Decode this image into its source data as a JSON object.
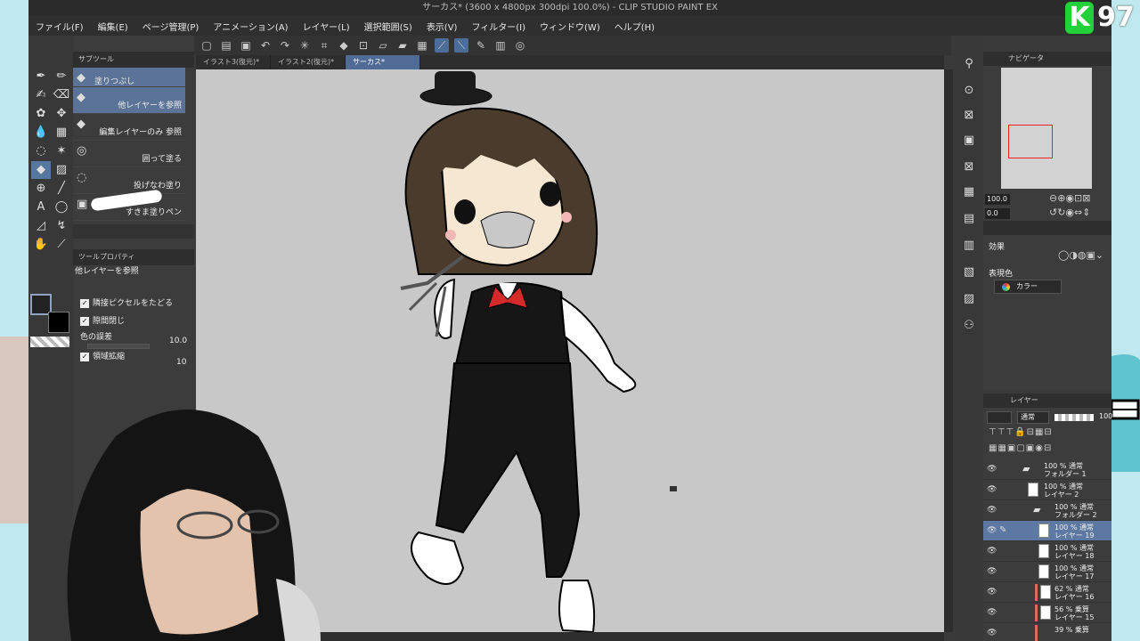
{
  "stream": {
    "badge_letter": "K",
    "badge_number": "97"
  },
  "app": {
    "title": "サーカス* (3600 x 4800px 300dpi 100.0%)  - CLIP STUDIO PAINT EX",
    "menu": [
      "ファイル(F)",
      "編集(E)",
      "ページ管理(P)",
      "アニメーション(A)",
      "レイヤー(L)",
      "選択範囲(S)",
      "表示(V)",
      "フィルター(I)",
      "ウィンドウ(W)",
      "ヘルプ(H)"
    ]
  },
  "subtool": {
    "header": "サブツール",
    "items": [
      "塗りつぶし",
      "他レイヤーを参照",
      "編集レイヤーのみ 参照",
      "囲って塗る",
      "投げなわ塗り",
      "すきま塗りペン"
    ]
  },
  "toolprop": {
    "header": "ツールプロパティ",
    "title": "他レイヤーを参照",
    "adjacent": "隣接ピクセルをたどる",
    "close_gap": "隙間閉じ",
    "tolerance_label": "色の誤差",
    "tolerance_value": "10.0",
    "expand_label": "領域拡縮",
    "expand_value": "10"
  },
  "tabs": [
    "イラスト3(復元)*",
    "イラスト2(復元)*",
    "サーカス*"
  ],
  "navigator": {
    "title": "ナビゲータ",
    "zoom": "100.0",
    "rotate": "0.0"
  },
  "effect": {
    "title": "効果",
    "color_label": "表現色",
    "color_value": "カラー"
  },
  "layers": {
    "title": "レイヤー",
    "blend": "通常",
    "opacity": "100",
    "items": [
      {
        "l1": "100 % 通常",
        "l2": "フォルダー 1",
        "type": "folder"
      },
      {
        "l1": "100 % 通常",
        "l2": "レイヤー 2",
        "type": "layer"
      },
      {
        "l1": "100 % 通常",
        "l2": "フォルダー 2",
        "type": "folder"
      },
      {
        "l1": "100 % 通常",
        "l2": "レイヤー 19",
        "type": "layer",
        "selected": true
      },
      {
        "l1": "100 % 通常",
        "l2": "レイヤー 18",
        "type": "layer"
      },
      {
        "l1": "100 % 通常",
        "l2": "レイヤー 17",
        "type": "layer"
      },
      {
        "l1": "62 % 通常",
        "l2": "レイヤー 16",
        "type": "layer",
        "marked": true
      },
      {
        "l1": "56 % 乗算",
        "l2": "レイヤー 15",
        "type": "layer",
        "marked": true
      },
      {
        "l1": "39 % 乗算",
        "l2": "",
        "type": "layer",
        "marked": true
      }
    ]
  },
  "colors": {
    "accent": "#56779f",
    "canvas": "#c8c8c9",
    "panel": "#3c3c3c"
  }
}
